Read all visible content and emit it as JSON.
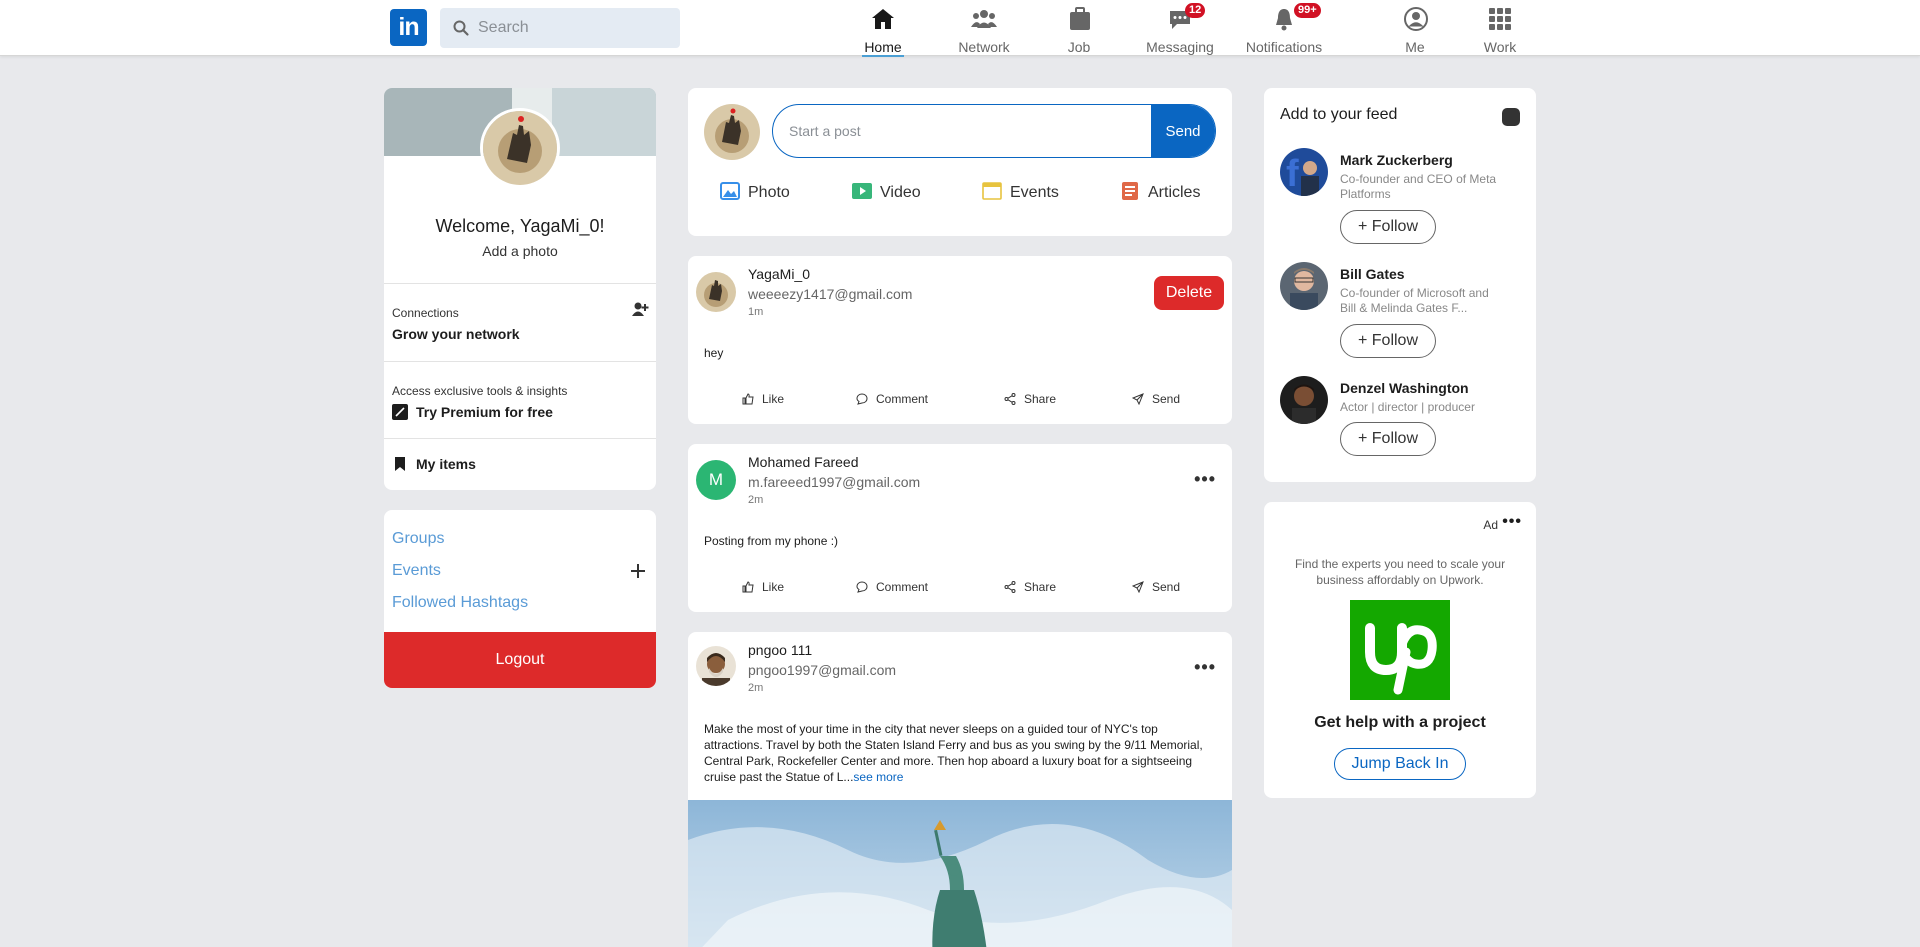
{
  "nav": {
    "search_placeholder": "Search",
    "items": [
      {
        "label": "Home"
      },
      {
        "label": "Network"
      },
      {
        "label": "Job"
      },
      {
        "label": "Messaging",
        "badge": "12"
      },
      {
        "label": "Notifications",
        "badge": "99+"
      },
      {
        "label": "Me"
      },
      {
        "label": "Work"
      }
    ]
  },
  "profile": {
    "welcome": "Welcome, YagaMi_0!",
    "add_photo": "Add a photo",
    "connections_label": "Connections",
    "grow_network": "Grow your network",
    "premium_caption": "Access exclusive tools & insights",
    "premium_link": "Try Premium for free",
    "my_items": "My items"
  },
  "sidebar_links": {
    "groups": "Groups",
    "events": "Events",
    "hashtags": "Followed Hashtags",
    "logout": "Logout"
  },
  "composer": {
    "placeholder": "Start a post",
    "send": "Send",
    "actions": [
      {
        "label": "Photo",
        "icon": "photo-icon",
        "color": "#378fe9"
      },
      {
        "label": "Video",
        "icon": "video-icon",
        "color": "#5f9b41"
      },
      {
        "label": "Events",
        "icon": "calendar-icon",
        "color": "#e7a33e"
      },
      {
        "label": "Articles",
        "icon": "article-icon",
        "color": "#e06847"
      }
    ]
  },
  "posts": [
    {
      "name": "YagaMi_0",
      "email": "weeeezy1417@gmail.com",
      "time": "1m",
      "body": "hey",
      "delete_label": "Delete"
    },
    {
      "name": "Mohamed Fareed",
      "email": "m.fareeed1997@gmail.com",
      "time": "2m",
      "body": "Posting from my phone :)",
      "avatar_letter": "M"
    },
    {
      "name": "pngoo 111",
      "email": "pngoo1997@gmail.com",
      "time": "2m",
      "body": "Make the most of your time in the city that never sleeps on a guided tour of NYC's top attractions. Travel by both the Staten Island Ferry and bus as you swing by the 9/11 Memorial, Central Park, Rockefeller Center and more. Then hop aboard a luxury boat for a sightseeing cruise past the Statue of L...",
      "see_more": "see more"
    }
  ],
  "post_actions": {
    "like": "Like",
    "comment": "Comment",
    "share": "Share",
    "send": "Send"
  },
  "feed": {
    "title": "Add to your feed",
    "follow_label": "+ Follow",
    "people": [
      {
        "name": "Mark Zuckerberg",
        "desc": "Co-founder and CEO of Meta Platforms"
      },
      {
        "name": "Bill Gates",
        "desc": "Co-founder of Microsoft and Bill & Melinda Gates F..."
      },
      {
        "name": "Denzel Washington",
        "desc": "Actor | director | producer"
      }
    ]
  },
  "ad": {
    "label": "Ad",
    "text": "Find the experts you need to scale your business affordably on Upwork.",
    "headline": "Get help with a project",
    "button": "Jump Back In"
  },
  "colors": {
    "brand": "#0a66c2",
    "danger": "#dd2a2a",
    "upwork": "#14a800"
  }
}
